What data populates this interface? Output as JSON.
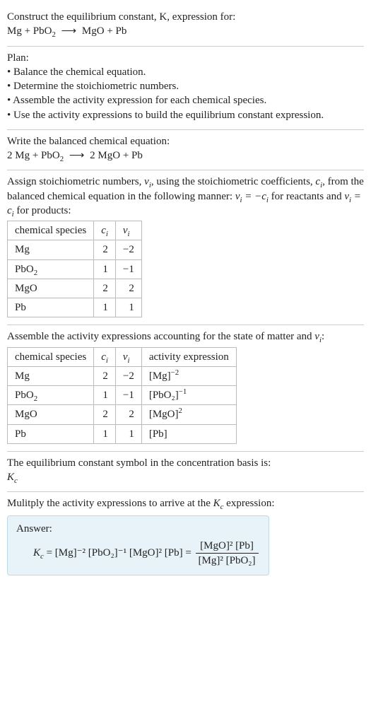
{
  "header": {
    "line1": "Construct the equilibrium constant, K, expression for:",
    "eq_lhs1": "Mg + PbO",
    "eq_sub1": "2",
    "eq_arrow": "⟶",
    "eq_rhs1": "MgO + Pb"
  },
  "plan": {
    "title": "Plan:",
    "b1": "• Balance the chemical equation.",
    "b2": "• Determine the stoichiometric numbers.",
    "b3": "• Assemble the activity expression for each chemical species.",
    "b4": "• Use the activity expressions to build the equilibrium constant expression."
  },
  "balanced": {
    "intro": "Write the balanced chemical equation:",
    "lhs": "2 Mg + PbO",
    "sub": "2",
    "arrow": "⟶",
    "rhs": "2 MgO + Pb"
  },
  "stoich": {
    "intro_a": "Assign stoichiometric numbers, ",
    "intro_b": ", using the stoichiometric coefficients, ",
    "intro_c": ", from the balanced chemical equation in the following manner: ",
    "intro_d": " for reactants and ",
    "intro_e": " for products:",
    "h_species": "chemical species",
    "h_ci": "cᵢ",
    "h_vi": "νᵢ",
    "rows": [
      {
        "sp": "Mg",
        "sub": "",
        "ci": "2",
        "vi": "−2"
      },
      {
        "sp": "PbO",
        "sub": "2",
        "ci": "1",
        "vi": "−1"
      },
      {
        "sp": "MgO",
        "sub": "",
        "ci": "2",
        "vi": "2"
      },
      {
        "sp": "Pb",
        "sub": "",
        "ci": "1",
        "vi": "1"
      }
    ]
  },
  "activity": {
    "intro_a": "Assemble the activity expressions accounting for the state of matter and ",
    "intro_b": ":",
    "h_species": "chemical species",
    "h_ci": "cᵢ",
    "h_vi": "νᵢ",
    "h_ae": "activity expression",
    "rows": [
      {
        "sp": "Mg",
        "sub": "",
        "ci": "2",
        "vi": "−2",
        "ae_base": "[Mg]",
        "ae_sup": "−2"
      },
      {
        "sp": "PbO",
        "sub": "2",
        "ci": "1",
        "vi": "−1",
        "ae_base": "[PbO₂]",
        "ae_sup": "−1"
      },
      {
        "sp": "MgO",
        "sub": "",
        "ci": "2",
        "vi": "2",
        "ae_base": "[MgO]",
        "ae_sup": "2"
      },
      {
        "sp": "Pb",
        "sub": "",
        "ci": "1",
        "vi": "1",
        "ae_base": "[Pb]",
        "ae_sup": ""
      }
    ]
  },
  "symbol": {
    "line1": "The equilibrium constant symbol in the concentration basis is:",
    "kc": "K",
    "kc_sub": "c"
  },
  "final": {
    "intro": "Mulitply the activity expressions to arrive at the ",
    "intro2": " expression:",
    "kc": "K",
    "kc_sub": "c",
    "answer_label": "Answer:",
    "eq_prefix": "K",
    "eq_prefix_sub": "c",
    "eq_eq": " = ",
    "flat": "[Mg]⁻² [PbO₂]⁻¹ [MgO]² [Pb] = ",
    "frac_top": "[MgO]² [Pb]",
    "frac_bot": "[Mg]² [PbO₂]"
  }
}
